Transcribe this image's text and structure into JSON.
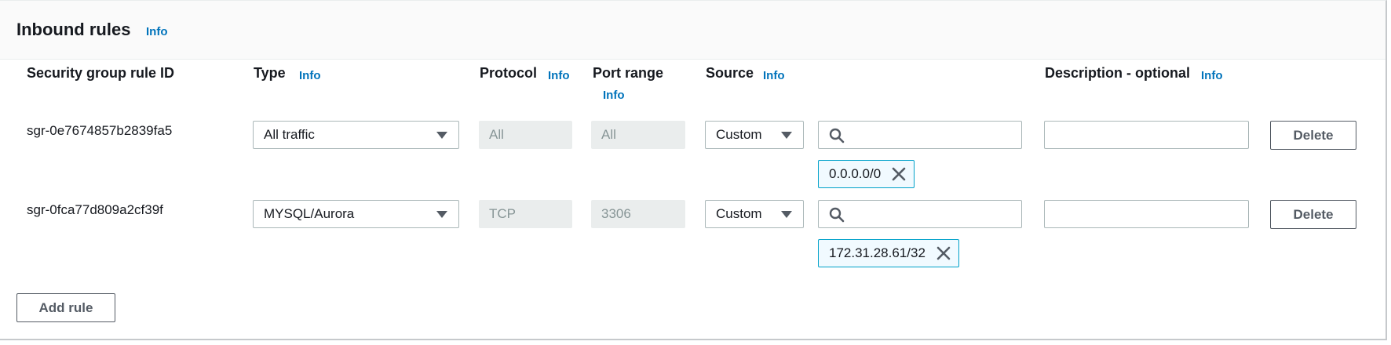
{
  "panel": {
    "title": "Inbound rules",
    "info": "Info"
  },
  "columns": {
    "rule_id": "Security group rule ID",
    "type": "Type",
    "type_info": "Info",
    "protocol": "Protocol",
    "protocol_info": "Info",
    "port_range": "Port range",
    "port_range_info": "Info",
    "source": "Source",
    "source_info": "Info",
    "description": "Description - optional",
    "description_info": "Info"
  },
  "rules": [
    {
      "id": "sgr-0e7674857b2839fa5",
      "type": "All traffic",
      "protocol": "All",
      "port_range": "All",
      "source_type": "Custom",
      "search_value": "",
      "token": "0.0.0.0/0",
      "description": "",
      "delete_label": "Delete"
    },
    {
      "id": "sgr-0fca77d809a2cf39f",
      "type": "MYSQL/Aurora",
      "protocol": "TCP",
      "port_range": "3306",
      "source_type": "Custom",
      "search_value": "",
      "token": "172.31.28.61/32",
      "description": "",
      "delete_label": "Delete"
    }
  ],
  "actions": {
    "add_rule": "Add rule"
  },
  "icons": {
    "dropdown": "caret-down-icon",
    "search": "search-icon",
    "remove_token": "close-icon"
  },
  "colors": {
    "link": "#0073bb",
    "token_border": "#00a1c9",
    "token_bg": "#f1faff",
    "disabled_bg": "#eaeded"
  }
}
